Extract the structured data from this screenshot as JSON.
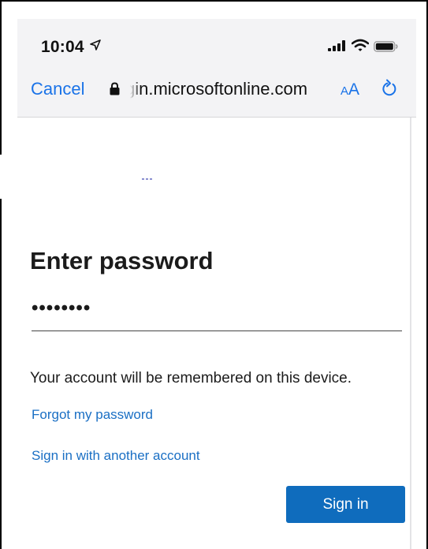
{
  "status_bar": {
    "time": "10:04",
    "icons": [
      "location-arrow-icon",
      "cellular-signal-icon",
      "wifi-icon",
      "battery-icon"
    ]
  },
  "browser": {
    "cancel_label": "Cancel",
    "url": "gin.microsoftonline.com",
    "text_size_small": "A",
    "text_size_big": "A",
    "icons": [
      "lock-icon",
      "reload-icon"
    ]
  },
  "form": {
    "title": "Enter password",
    "password_masked": "••••••••",
    "remember_text": "Your account will be remembered on this device.",
    "forgot_link": "Forgot my password",
    "other_account_link": "Sign in with another account",
    "sign_in_label": "Sign in"
  },
  "colors": {
    "link": "#1a6fc4",
    "ios_blue": "#1a73e8",
    "primary_button": "#0f6cbd",
    "chrome_bg": "#f3f3f5",
    "text": "#1b1b1b"
  }
}
